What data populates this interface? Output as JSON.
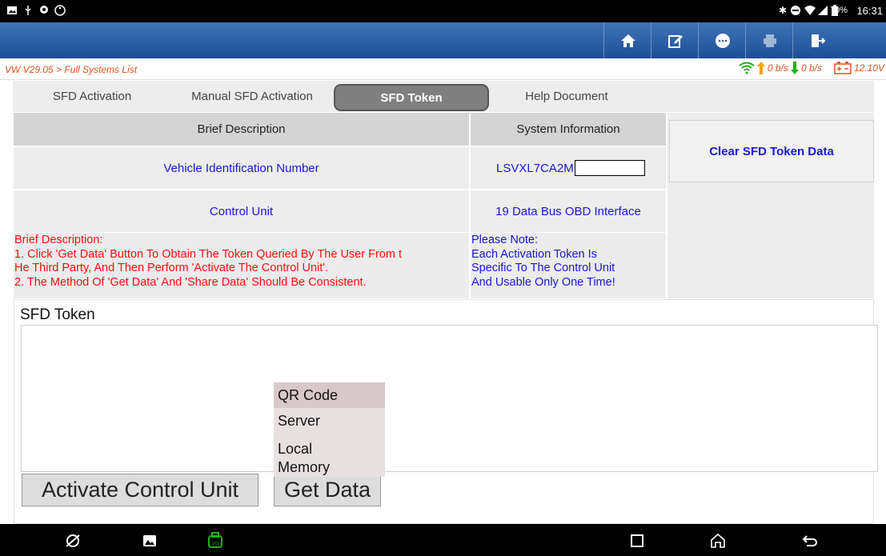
{
  "status_bar": {
    "battery": "70%",
    "time": "16:31"
  },
  "toolbar": {
    "buttons": [
      "home-icon",
      "edit-icon",
      "message-icon",
      "print-icon",
      "exit-icon"
    ]
  },
  "breadcrumb": "VW V29.05 > Full Systems List",
  "network": {
    "upload": "0 b/s",
    "download": "0 b/s",
    "voltage": "12.10V"
  },
  "tabs": [
    {
      "label": "SFD Activation"
    },
    {
      "label": "Manual SFD Activation"
    },
    {
      "label": "SFD Token",
      "active": true
    },
    {
      "label": "Help Document"
    }
  ],
  "table": {
    "headers": [
      "Brief Description",
      "System Information"
    ],
    "rows": [
      {
        "description": "Vehicle Identification Number",
        "value": "LSVXL7CA2M"
      },
      {
        "description": "Control Unit",
        "value": "19 Data Bus OBD Interface"
      }
    ]
  },
  "clear_button": "Clear SFD Token Data",
  "notes_left": [
    "Brief Description:",
    "1. Click 'Get Data' Button To Obtain The Token Queried By The User From t",
    "He Third Party, And Then Perform 'Activate The Control Unit'.",
    "2. The Method Of 'Get Data' And 'Share Data' Should Be Consistent."
  ],
  "notes_right": [
    "Please Note:",
    "Each Activation Token Is",
    "Specific To The Control Unit",
    "And Usable Only One Time!"
  ],
  "token": {
    "label": "SFD Token",
    "value": ""
  },
  "buttons": {
    "activate": "Activate Control Unit",
    "get_data": "Get Data"
  },
  "dropdown": {
    "options": [
      "QR Code",
      "Server",
      "Local",
      "Memory"
    ],
    "highlighted": "QR Code"
  },
  "colors": {
    "toolbar": "#2a5ea4",
    "link_blue": "#1a17d6",
    "warning_red": "#ff1010",
    "breadcrumb_orange": "#e0521f",
    "net_green": "#22b01a",
    "arrow_orange": "#f5a300"
  }
}
